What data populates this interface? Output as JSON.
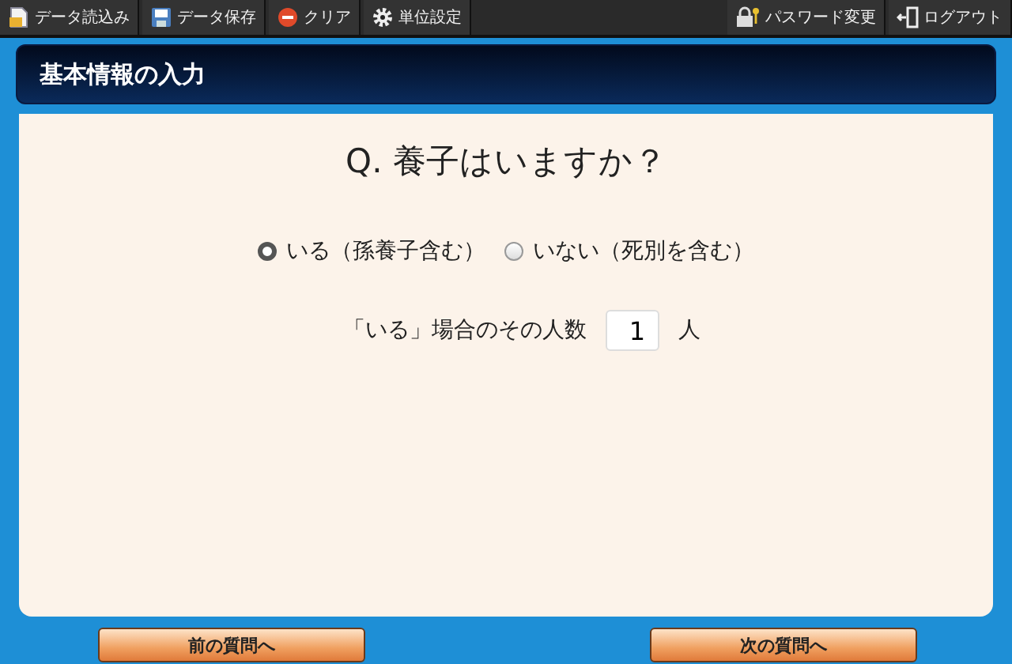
{
  "toolbar": {
    "left": [
      {
        "kind": "load",
        "label": "データ読込み"
      },
      {
        "kind": "save",
        "label": "データ保存"
      },
      {
        "kind": "clear",
        "label": "クリア"
      },
      {
        "kind": "settings",
        "label": "単位設定"
      }
    ],
    "right": [
      {
        "kind": "password",
        "label": "パスワード変更"
      },
      {
        "kind": "logout",
        "label": "ログアウト"
      }
    ]
  },
  "header": {
    "title": "基本情報の入力"
  },
  "question": "Q. 養子はいますか？",
  "options": [
    {
      "label": "いる（孫養子含む）",
      "selected": true
    },
    {
      "label": "いない（死別を含む）",
      "selected": false
    }
  ],
  "count": {
    "label": "「いる」場合のその人数",
    "value": "1",
    "unit": "人"
  },
  "nav": {
    "prev": "前の質問へ",
    "next": "次の質問へ"
  }
}
